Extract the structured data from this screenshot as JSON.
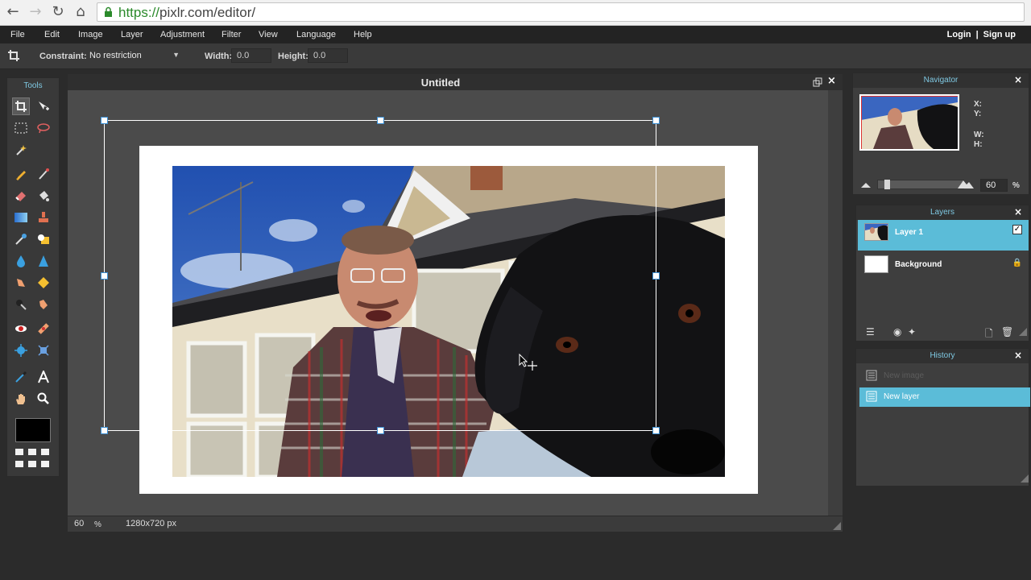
{
  "browser": {
    "back_icon": "back-arrow-icon",
    "forward_icon": "forward-arrow-icon",
    "reload_icon": "reload-icon",
    "home_icon": "home-icon",
    "url_scheme": "https://",
    "url_rest": "pixlr.com/editor/"
  },
  "menu": {
    "items": [
      "File",
      "Edit",
      "Image",
      "Layer",
      "Adjustment",
      "Filter",
      "View",
      "Language",
      "Help"
    ],
    "login": "Login",
    "separator": "|",
    "signup": "Sign up"
  },
  "options": {
    "constraint_label": "Constraint:",
    "constraint_value": "No restriction",
    "width_label": "Width:",
    "width_value": "0.0",
    "height_label": "Height:",
    "height_value": "0.0"
  },
  "tools": {
    "title": "Tools",
    "active": "crop-tool"
  },
  "document": {
    "title": "Untitled",
    "zoom_value": "60",
    "zoom_unit": "%",
    "dimensions": "1280x720 px"
  },
  "navigator": {
    "title": "Navigator",
    "x_label": "X:",
    "y_label": "Y:",
    "w_label": "W:",
    "h_label": "H:",
    "zoom_value": "60",
    "zoom_unit": "%",
    "zoom_level": 0.6
  },
  "layers": {
    "title": "Layers",
    "items": [
      {
        "name": "Layer 1",
        "selected": true,
        "visible": true
      },
      {
        "name": "Background",
        "selected": false,
        "locked": true
      }
    ]
  },
  "history": {
    "title": "History",
    "items": [
      {
        "label": "New image",
        "selected": false
      },
      {
        "label": "New layer",
        "selected": true
      }
    ]
  },
  "colors": {
    "accent": "#5bbcd8",
    "panel_title": "#7fc9e3",
    "handle_border": "#3b8fd4"
  }
}
